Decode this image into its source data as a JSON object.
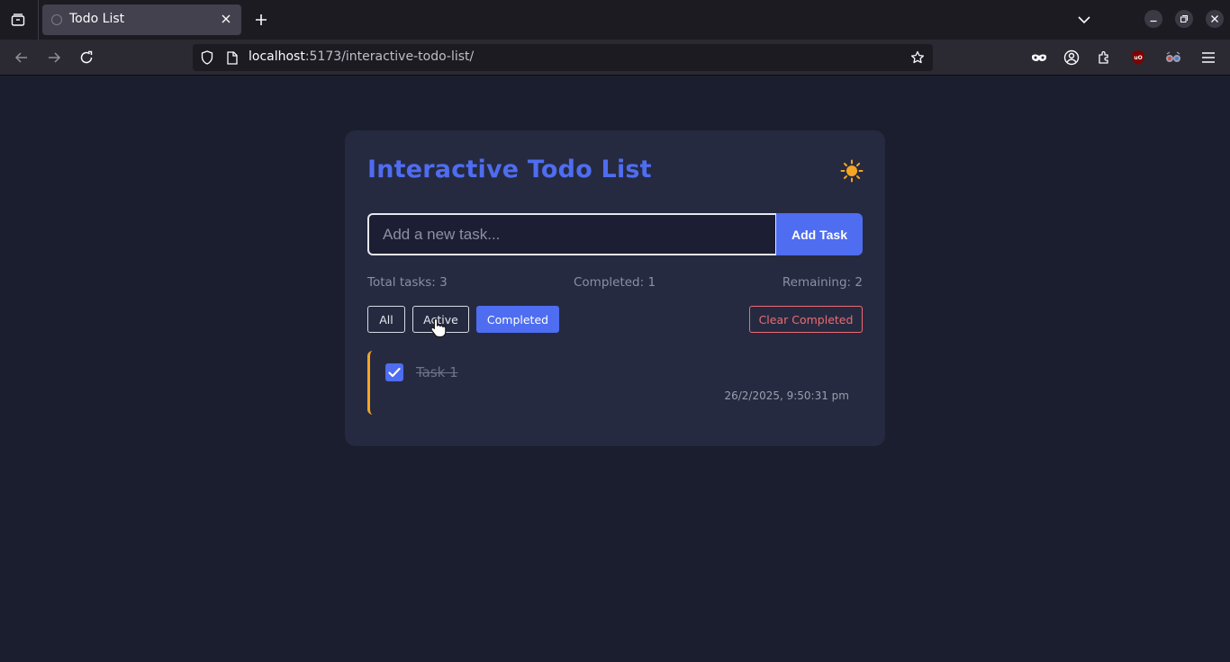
{
  "browser": {
    "tab_title": "Todo List",
    "url_host": "localhost",
    "url_rest": ":5173/interactive-todo-list/"
  },
  "app": {
    "title": "Interactive Todo List",
    "theme_icon": "sun-icon",
    "input": {
      "placeholder": "Add a new task...",
      "value": ""
    },
    "add_button": "Add Task",
    "stats": {
      "total": "Total tasks: 3",
      "completed": "Completed: 1",
      "remaining": "Remaining: 2"
    },
    "filters": [
      {
        "label": "All",
        "active": false
      },
      {
        "label": "Active",
        "active": false
      },
      {
        "label": "Completed",
        "active": true
      }
    ],
    "clear_button": "Clear Completed",
    "todos": [
      {
        "text": "Task 1",
        "date": "26/2/2025, 9:50:31 pm",
        "completed": true
      }
    ]
  },
  "colors": {
    "background": "#1b1e2e",
    "card": "#262a40",
    "accent": "#4e6df0",
    "danger": "#ee6b72",
    "priority": "#f5a524",
    "sun": "#f5a524"
  }
}
